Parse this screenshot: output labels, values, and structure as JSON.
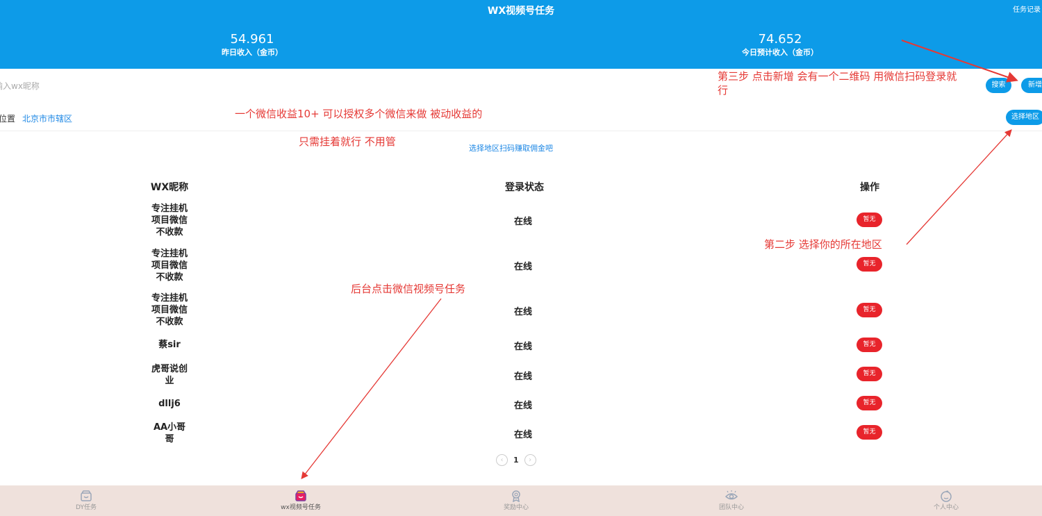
{
  "header": {
    "title": "WX视频号任务",
    "record_link": "任务记录",
    "yesterday_value": "54.961",
    "yesterday_label": "昨日收入（金币）",
    "today_value": "74.652",
    "today_label": "今日预计收入（金币）"
  },
  "search": {
    "placeholder": "输入wx昵称",
    "search_button": "搜索",
    "add_button": "新增"
  },
  "location": {
    "label": "前位置",
    "city": "北京市市辖区",
    "select_button": "选择地区"
  },
  "hint_link": "选择地区扫码赚取佣金吧",
  "annotations": {
    "step3": "第三步 点击新增 会有一个二维码 用微信扫码登录就行",
    "income": "一个微信收益10+ 可以授权多个微信来做 被动收益的",
    "idle": "只需挂着就行 不用管",
    "step2": "第二步 选择你的所在地区",
    "backend": "后台点击微信视频号任务"
  },
  "table": {
    "headers": [
      "WX昵称",
      "登录状态",
      "操作"
    ],
    "rows": [
      {
        "name": "专注挂机项目微信不收款",
        "status": "在线",
        "action": "暂无"
      },
      {
        "name": "专注挂机项目微信不收款",
        "status": "在线",
        "action": "暂无"
      },
      {
        "name": "专注挂机项目微信不收款",
        "status": "在线",
        "action": "暂无"
      },
      {
        "name": "蔡sir",
        "status": "在线",
        "action": "暂无"
      },
      {
        "name": "虎哥说创业",
        "status": "在线",
        "action": "暂无"
      },
      {
        "name": "dllj6",
        "status": "在线",
        "action": "暂无"
      },
      {
        "name": "AA小哥哥",
        "status": "在线",
        "action": "暂无"
      }
    ]
  },
  "pagination": {
    "prev": "‹",
    "current": "1",
    "next": "›"
  },
  "tabbar": {
    "items": [
      {
        "label": "DY任务",
        "icon": "shop-icon"
      },
      {
        "label": "wx视频号任务",
        "icon": "shop-icon",
        "active": true
      },
      {
        "label": "奖励中心",
        "icon": "medal-icon"
      },
      {
        "label": "团队中心",
        "icon": "eye-icon"
      },
      {
        "label": "个人中心",
        "icon": "face-icon"
      }
    ]
  },
  "colors": {
    "primary": "#0d9be8",
    "danger": "#e8242b",
    "annotation": "#e53935",
    "tabbar_bg": "#efe1dc"
  }
}
